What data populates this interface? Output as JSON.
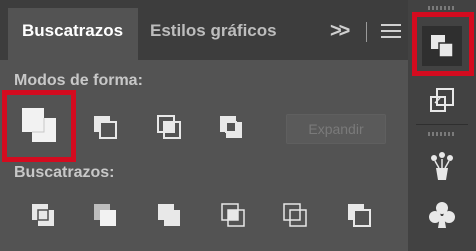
{
  "tabs": {
    "active_label": "Buscatrazos",
    "inactive_label": "Estilos gráficos",
    "more_label": ">>"
  },
  "shape_modes": {
    "label": "Modos de forma:",
    "buttons": [
      "unite-icon",
      "minus-front-icon",
      "intersect-icon",
      "exclude-icon"
    ],
    "expand_label": "Expandir",
    "expand_enabled": false
  },
  "pathfinders": {
    "label": "Buscatrazos:",
    "buttons": [
      "divide-icon",
      "trim-icon",
      "merge-icon",
      "crop-icon",
      "outline-icon",
      "minus-back-icon"
    ]
  },
  "dock": {
    "items": [
      "pathfinder-panel-icon",
      "transform-panel-icon",
      "symbol-sprayer-icon",
      "symbols-club-icon"
    ],
    "active_item": "pathfinder-panel-icon"
  },
  "colors": {
    "highlight": "#d40b1f",
    "panel_bg": "#535353",
    "tabbar_bg": "#3d3d3d",
    "dock_bg": "#424242"
  }
}
